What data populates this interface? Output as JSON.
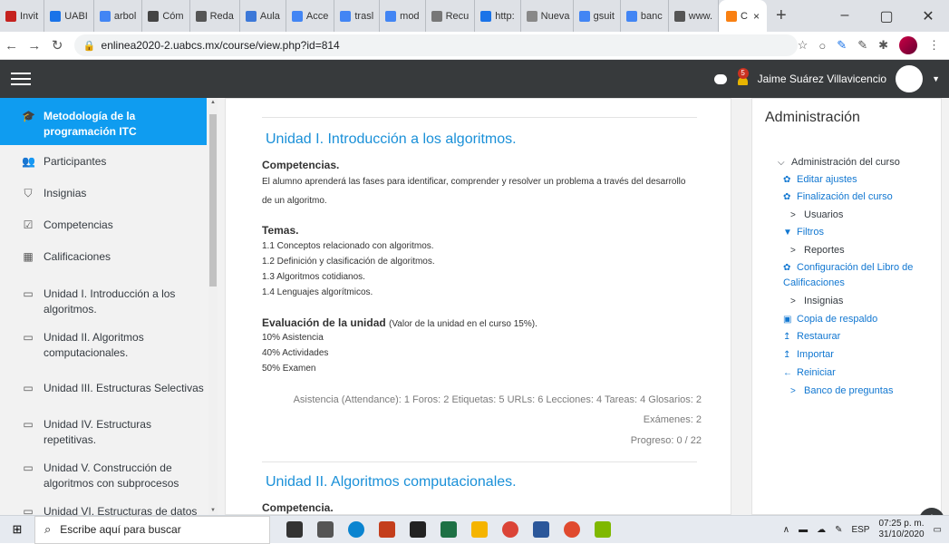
{
  "browser": {
    "tabs": [
      {
        "label": "Invit",
        "color": "#c5221f"
      },
      {
        "label": "UABI",
        "color": "#1a73e8"
      },
      {
        "label": "arbol",
        "color": "#4285f4"
      },
      {
        "label": "Cóm",
        "color": "#444444"
      },
      {
        "label": "Reda",
        "color": "#555555"
      },
      {
        "label": "Aula",
        "color": "#3c78d8"
      },
      {
        "label": "Acce",
        "color": "#4285f4"
      },
      {
        "label": "trasl",
        "color": "#4285f4"
      },
      {
        "label": "mod",
        "color": "#4285f4"
      },
      {
        "label": "Recu",
        "color": "#777777"
      },
      {
        "label": "http:",
        "color": "#1a73e8"
      },
      {
        "label": "Nueva pe",
        "color": "#888888"
      },
      {
        "label": "gsuit",
        "color": "#4285f4"
      },
      {
        "label": "banc",
        "color": "#4285f4"
      },
      {
        "label": "www.",
        "color": "#555555"
      }
    ],
    "active_tab": {
      "label": "C",
      "close": "×"
    },
    "new_tab": "+",
    "url": "enlinea2020-2.uabcs.mx/course/view.php?id=814",
    "window_controls": [
      "–",
      "▢",
      "✕"
    ]
  },
  "navbar": {
    "notification_count": "5",
    "user_name": "Jaime Suárez Villavicencio"
  },
  "drawer": {
    "items": [
      {
        "label": "Metodología de la programación ITC",
        "icon": "graduation-cap-icon",
        "glyph": "🎓"
      },
      {
        "label": "Participantes",
        "icon": "users-icon",
        "glyph": "👥"
      },
      {
        "label": "Insignias",
        "icon": "shield-icon",
        "glyph": "⛉"
      },
      {
        "label": "Competencias",
        "icon": "check-square-icon",
        "glyph": "☑"
      },
      {
        "label": "Calificaciones",
        "icon": "table-icon",
        "glyph": "▦"
      },
      {
        "label": "Unidad I. Introducción a los algoritmos.",
        "icon": "folder-icon",
        "glyph": "▭"
      },
      {
        "label": "Unidad II. Algoritmos computacionales.",
        "icon": "folder-icon",
        "glyph": "▭"
      },
      {
        "label": "Unidad III. Estructuras Selectivas",
        "icon": "folder-icon",
        "glyph": "▭"
      },
      {
        "label": "Unidad IV. Estructuras repetitivas.",
        "icon": "folder-icon",
        "glyph": "▭"
      },
      {
        "label": "Unidad V. Construcción de algoritmos con subprocesos",
        "icon": "folder-icon",
        "glyph": "▭"
      },
      {
        "label": "Unidad VI. Estructuras de datos",
        "icon": "folder-icon",
        "glyph": "▭"
      }
    ]
  },
  "main": {
    "unit1": {
      "title": "Unidad I. Introducción a los algoritmos.",
      "competencias_heading": "Competencias.",
      "competencias_text_1": "El alumno aprenderá las fases para identificar, comprender y resolver un problema a través del desarrollo",
      "competencias_text_2": "de un algoritmo.",
      "temas_heading": "Temas.",
      "temas": [
        "1.1 Conceptos relacionado con algoritmos.",
        "1.2 Definición y clasificación de algoritmos.",
        "1.3 Algoritmos cotidianos.",
        "1.4 Lenguajes algorítmicos."
      ],
      "evaluacion_heading": "Evaluación de la unidad",
      "evaluacion_note": "(Valor de la unidad en el curso 15%).",
      "evaluacion": [
        "10% Asistencia",
        "40% Actividades",
        "50% Examen"
      ],
      "stats_line_1": "Asistencia (Attendance): 1  Foros: 2  Etiquetas: 5  URLs: 6  Lecciones: 4  Tareas: 4  Glosarios: 2",
      "stats_line_2": "Exámenes: 2",
      "progress": "Progreso: 0 / 22"
    },
    "unit2": {
      "title": "Unidad II. Algoritmos computacionales.",
      "competencia_heading": "Competencia."
    }
  },
  "admin": {
    "title": "Administración",
    "items": [
      {
        "label": "Administración del curso",
        "prefix": "⌵",
        "link": false
      },
      {
        "label": "Editar ajustes",
        "prefix": "✿",
        "link": true
      },
      {
        "label": "Finalización del curso",
        "prefix": "✿",
        "link": true
      },
      {
        "label": "Usuarios",
        "prefix": ">",
        "link": false
      },
      {
        "label": "Filtros",
        "prefix": "▼",
        "link": true
      },
      {
        "label": "Reportes",
        "prefix": ">",
        "link": false
      },
      {
        "label": "Configuración del Libro de",
        "prefix": "✿",
        "link": true
      },
      {
        "label": "Calificaciones",
        "prefix": "",
        "link": true
      },
      {
        "label": "Insignias",
        "prefix": ">",
        "link": false
      },
      {
        "label": "Copia de respaldo",
        "prefix": "▣",
        "link": true
      },
      {
        "label": "Restaurar",
        "prefix": "↥",
        "link": true
      },
      {
        "label": "Importar",
        "prefix": "↥",
        "link": true
      },
      {
        "label": "Reiniciar",
        "prefix": "←",
        "link": true
      },
      {
        "label": "Banco de preguntas",
        "prefix": ">",
        "link": true
      }
    ]
  },
  "taskbar": {
    "search_placeholder": "Escribe aquí para buscar",
    "language": "ESP",
    "time": "07:25 p. m.",
    "date": "31/10/2020",
    "app_colors": [
      "#333333",
      "#555555",
      "#0a84d0",
      "#c43e1c",
      "#222222",
      "#1e7145",
      "#f5b400",
      "#db4437",
      "#2b579a",
      "#e04a2f",
      "#7fb800"
    ]
  }
}
